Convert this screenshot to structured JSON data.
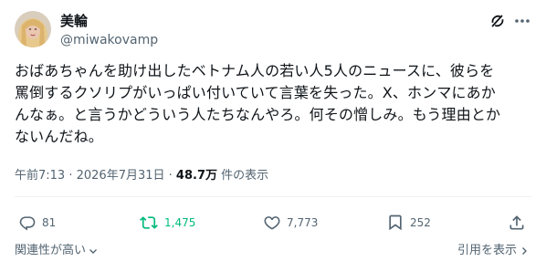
{
  "author": {
    "display_name": "美輪",
    "handle": "@miwakovamp",
    "avatar_icon": "avatar-photo"
  },
  "header_icons": {
    "grok": "grok-icon",
    "more": "more-icon"
  },
  "post": {
    "lines": [
      "おばあちゃんを助け出したベトナム人の若い人5人のニュースに、彼らを",
      "罵倒するクソリプがいっぱい付いていて言葉を失った。X、ホンマにあか",
      "んなぁ。と言うかどういう人たちなんやろ。何その憎しみ。もう理由とか",
      "ないんだね。"
    ]
  },
  "meta": {
    "time": "午前7:13",
    "separator": " · ",
    "date": "2026年7月31日",
    "views_count": "48.7万",
    "views_label": " 件の表示"
  },
  "actions": {
    "reply": {
      "icon": "reply-icon",
      "count": "81"
    },
    "retweet": {
      "icon": "retweet-icon",
      "count": "1,475",
      "color": "#00ba7c"
    },
    "like": {
      "icon": "heart-icon",
      "count": "7,773"
    },
    "bookmark": {
      "icon": "bookmark-icon",
      "count": "252"
    },
    "share": {
      "icon": "share-icon"
    }
  },
  "footer": {
    "sort_label": "関連性が高い",
    "quotes_label": "引用を表示"
  },
  "colors": {
    "text": "#0f1419",
    "secondary": "#536471",
    "retweet_active": "#00ba7c",
    "divider": "#eff3f4"
  }
}
